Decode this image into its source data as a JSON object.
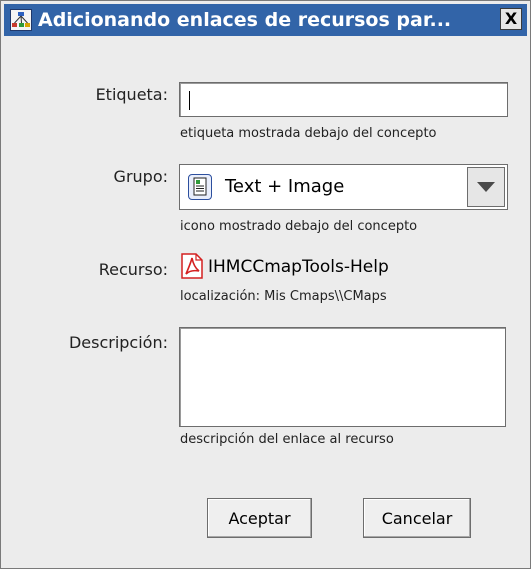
{
  "window": {
    "title": "Adicionando enlaces de recursos par...",
    "close_label": "X",
    "app_icon": "cmaptools-network-icon"
  },
  "form": {
    "etiqueta": {
      "label": "Etiqueta:",
      "value": "",
      "hint": "etiqueta mostrada debajo del concepto"
    },
    "grupo": {
      "label": "Grupo:",
      "selected": "Text + Image",
      "icon": "text-image-icon",
      "hint": "icono mostrado debajo del concepto"
    },
    "recurso": {
      "label": "Recurso:",
      "name": "IHMCCmapTools-Help",
      "icon": "pdf-icon",
      "location": "localización: Mis Cmaps\\\\CMaps"
    },
    "descripcion": {
      "label": "Descripción:",
      "value": "",
      "hint": "descripción del enlace al recurso"
    }
  },
  "buttons": {
    "accept": "Aceptar",
    "cancel": "Cancelar"
  },
  "colors": {
    "titlebar": "#3264a8",
    "window_bg": "#ececec",
    "pdf_red": "#d42020"
  }
}
